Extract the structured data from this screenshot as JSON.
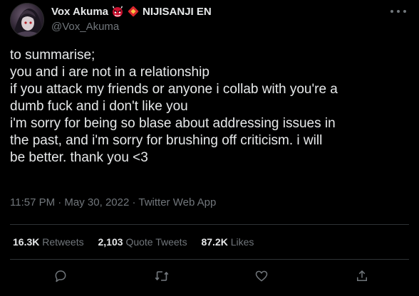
{
  "author": {
    "display_name": "Vox Akuma",
    "emoji_1": "oni-mask-emoji",
    "emoji_2": "red-diamond-emoji",
    "org_name": "NIJISANJI EN",
    "handle": "@Vox_Akuma"
  },
  "tweet": {
    "lines": [
      "to summarise;",
      "you and i are not in a relationship",
      "if you attack my friends or anyone i collab with you're a",
      "dumb fuck and i don't like you",
      "i'm sorry for being so blase about addressing issues in",
      "the past, and i'm sorry for brushing off criticism. i will",
      "be better. thank you <3"
    ],
    "timestamp": "11:57 PM · May 30, 2022 · Twitter Web App"
  },
  "stats": {
    "retweets_count": "16.3K",
    "retweets_label": "Retweets",
    "quotes_count": "2,103",
    "quotes_label": "Quote Tweets",
    "likes_count": "87.2K",
    "likes_label": "Likes"
  },
  "actions": [
    "reply-icon",
    "retweet-icon",
    "like-icon",
    "share-icon"
  ],
  "colors": {
    "background": "#000000",
    "text": "#e7e9ea",
    "muted": "#71767b",
    "divider": "#2f3336",
    "emoji_red": "#c8102e"
  }
}
